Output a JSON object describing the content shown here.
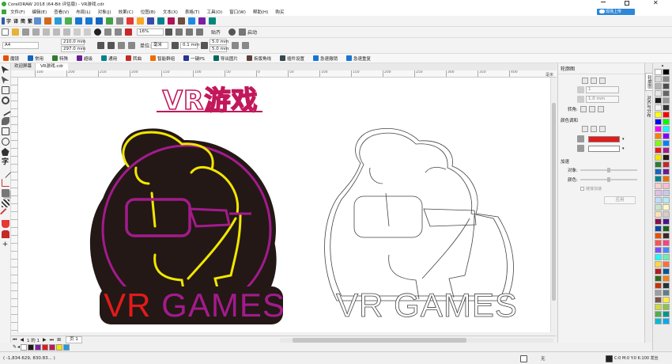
{
  "app": {
    "title": "CorelDRAW 2018 (64-Bit 评估版) - VR游戏.cdr",
    "cloud_label": "现场上传"
  },
  "menu": [
    "文件(F)",
    "编辑(E)",
    "查看(V)",
    "布局(L)",
    "对象(J)",
    "效果(C)",
    "位图(B)",
    "文本(X)",
    "表格(T)",
    "工具(O)",
    "窗口(W)",
    "帮助(H)",
    "购买"
  ],
  "toolbar": {
    "zoom": "16%",
    "snap": "贴齐",
    "launch": "启动"
  },
  "propbar": {
    "page": "A4",
    "width": "210.0 mm",
    "height": "297.0 mm",
    "units_label": "单位:",
    "units": "毫米",
    "nudge": "0.1 mm",
    "dup_x": "5.0 mm",
    "dup_y": "5.0 mm"
  },
  "plugins": [
    "魔镜",
    "常用",
    "特殊",
    "超级",
    "通用",
    "转曲",
    "智能群组",
    "一键PS",
    "导出图片",
    "拆版角线",
    "插件设置",
    "急速撤销",
    "急速重复"
  ],
  "tabs": [
    "欢迎屏幕",
    "VR游戏.cdr"
  ],
  "ruler_marks": [
    "100",
    "200",
    "250",
    "200",
    "150",
    "100",
    "50",
    "0",
    "50",
    "100",
    "150",
    "200",
    "250",
    "300",
    "350",
    "400"
  ],
  "ruler_unit": "毫米",
  "design": {
    "title": "VR游戏",
    "logo_text": "VR GAMES"
  },
  "docker": {
    "title": "轮廓图",
    "steps": "1",
    "offset": "1.0 mm",
    "corner_label": "转角:",
    "color_section": "颜色调和",
    "accel_section": "加速",
    "objects_label": "对象:",
    "colors_label": "颜色:",
    "link_label": "链接加速",
    "apply": "应用",
    "side_tabs": [
      "轮廓图",
      "对齐与分布"
    ]
  },
  "page_nav": {
    "counter": "1 的 1",
    "page_tab": "页 1"
  },
  "status": {
    "coords": "( -1,834.629, 830.83... )",
    "fill": "无",
    "outline": "C:0 M:0 Y:0 K:100 发丝"
  },
  "colors": {
    "accent": "#e21b1b",
    "magenta": "#a31b8c",
    "yellow": "#f2e600",
    "dark": "#231815"
  }
}
